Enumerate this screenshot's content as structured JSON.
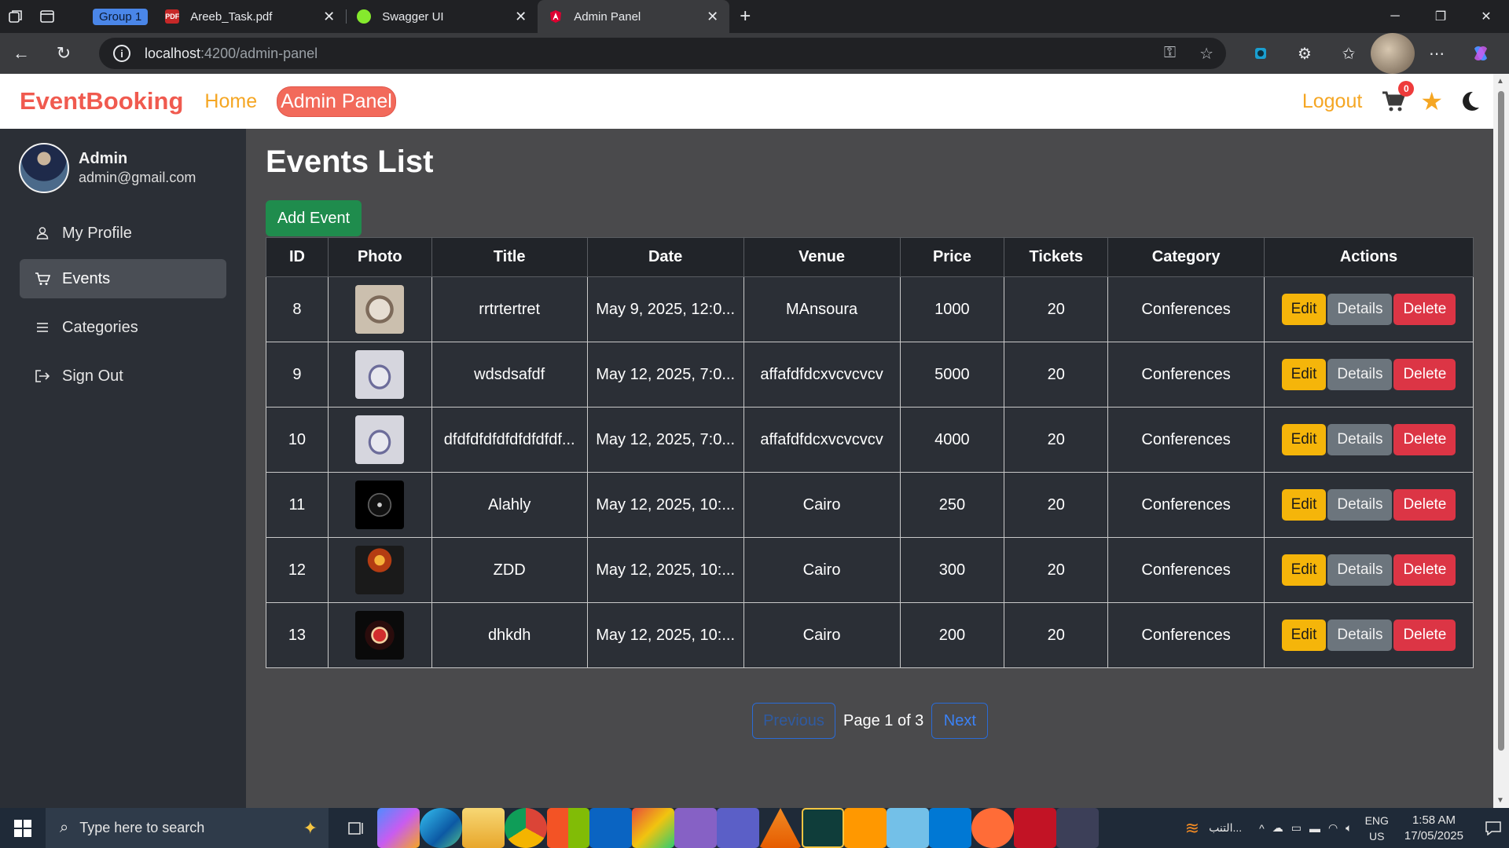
{
  "browser": {
    "tab_group": "Group 1",
    "tabs": [
      {
        "title": "Areeb_Task.pdf",
        "favicon_label": "PDF",
        "favicon_color": "#c62828"
      },
      {
        "title": "Swagger UI",
        "favicon_color": "#85ea2d"
      },
      {
        "title": "Admin Panel",
        "favicon_color": "#dd0031"
      }
    ],
    "url_host": "localhost",
    "url_path": ":4200/admin-panel"
  },
  "navbar": {
    "brand": "EventBooking",
    "home": "Home",
    "admin_panel": "Admin Panel",
    "logout": "Logout",
    "cart_count": "0"
  },
  "sidebar": {
    "user_name": "Admin",
    "user_email": "admin@gmail.com",
    "items": [
      {
        "label": "My Profile",
        "icon": "user-icon"
      },
      {
        "label": "Events",
        "icon": "cart-icon"
      },
      {
        "label": "Categories",
        "icon": "list-icon"
      },
      {
        "label": "Sign Out",
        "icon": "sign-out-icon"
      }
    ]
  },
  "main": {
    "title": "Events List",
    "add_button": "Add Event",
    "columns": [
      "ID",
      "Photo",
      "Title",
      "Date",
      "Venue",
      "Price",
      "Tickets",
      "Category",
      "Actions"
    ],
    "rows": [
      {
        "id": "8",
        "title": "rrtrtertret",
        "date": "May 9, 2025, 12:0...",
        "venue": "MAnsoura",
        "price": "1000",
        "tickets": "20",
        "category": "Conferences"
      },
      {
        "id": "9",
        "title": "wdsdsafdf",
        "date": "May 12, 2025, 7:0...",
        "venue": "affafdfdcxvcvcvcv",
        "price": "5000",
        "tickets": "20",
        "category": "Conferences"
      },
      {
        "id": "10",
        "title": "dfdfdfdfdfdfdfdfdf...",
        "date": "May 12, 2025, 7:0...",
        "venue": "affafdfdcxvcvcvcv",
        "price": "4000",
        "tickets": "20",
        "category": "Conferences"
      },
      {
        "id": "11",
        "title": "Alahly",
        "date": "May 12, 2025, 10:...",
        "venue": "Cairo",
        "price": "250",
        "tickets": "20",
        "category": "Conferences"
      },
      {
        "id": "12",
        "title": "ZDD",
        "date": "May 12, 2025, 10:...",
        "venue": "Cairo",
        "price": "300",
        "tickets": "20",
        "category": "Conferences"
      },
      {
        "id": "13",
        "title": "dhkdh",
        "date": "May 12, 2025, 10:...",
        "venue": "Cairo",
        "price": "200",
        "tickets": "20",
        "category": "Conferences"
      }
    ],
    "actions": {
      "edit": "Edit",
      "details": "Details",
      "delete": "Delete"
    },
    "pagination": {
      "previous": "Previous",
      "label": "Page 1 of 3",
      "next": "Next"
    }
  },
  "taskbar": {
    "search_placeholder": "Type here to search",
    "tray_text": "التنب...",
    "lang_top": "ENG",
    "lang_bottom": "US",
    "time": "1:58 AM",
    "date": "17/05/2025"
  },
  "colors": {
    "brand": "#f05a4f",
    "accent": "#f5a623",
    "add_button": "#1f8c4d",
    "edit": "#f5b50a",
    "details": "#6c757d",
    "delete": "#dc3545"
  }
}
